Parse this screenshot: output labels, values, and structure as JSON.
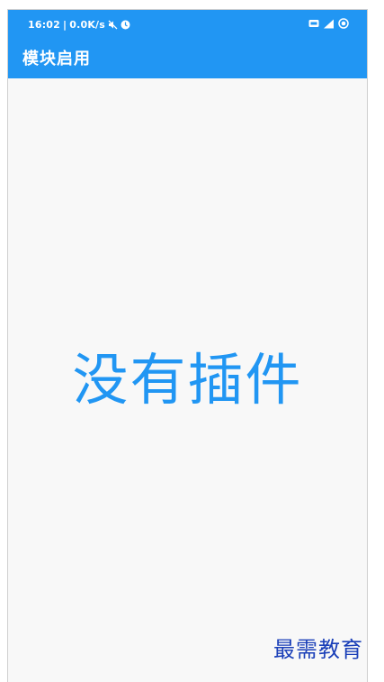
{
  "status_bar": {
    "time": "16:02",
    "separator": "|",
    "network_speed": "0.0K/s",
    "icons": [
      "mute-icon",
      "alarm-icon",
      "hd-icon",
      "signal-icon",
      "battery-icon"
    ]
  },
  "app_bar": {
    "title": "模块启用"
  },
  "main": {
    "empty_message": "没有插件"
  },
  "watermark": {
    "text": "最需教育"
  },
  "colors": {
    "primary": "#2196f3",
    "background": "#f8f8f8",
    "watermark": "#1a3fb8"
  }
}
